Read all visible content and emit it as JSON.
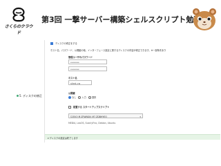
{
  "header": {
    "logo_text": "さくらのクラウド",
    "title": "第3回 一撃サーバー構築シェルスクリプト勉強会"
  },
  "section": {
    "marker": "5.",
    "label": "ディスクの修正"
  },
  "panel": {
    "modify_disk_checkbox_label": "ディスクの修正をする",
    "description": "ホスト名、パスワード、公開鍵の他、インターフェース設定に関するディスクの内容が修正できます。※一部条件あり",
    "admin_password_label": "管理ユーザのパスワード",
    "password_placeholder": "********",
    "confirm_placeholder": "********",
    "hostname_label": "ホスト名",
    "hostname_value": "sitest-cw",
    "public_key_label": "公開鍵",
    "key_options": [
      "なし",
      "入力",
      "選択"
    ],
    "startup_script_checkbox_label": "配置する スタートアップスクリプト",
    "script_selected": "[2350] M  ZFWNGN_M7 ZDBHYEO",
    "script_note": "MEDIA, LeoOS, ScanlyFinc, Debian, Ubuntu",
    "footer_note": "▾ ディスクの設定は終了します"
  }
}
